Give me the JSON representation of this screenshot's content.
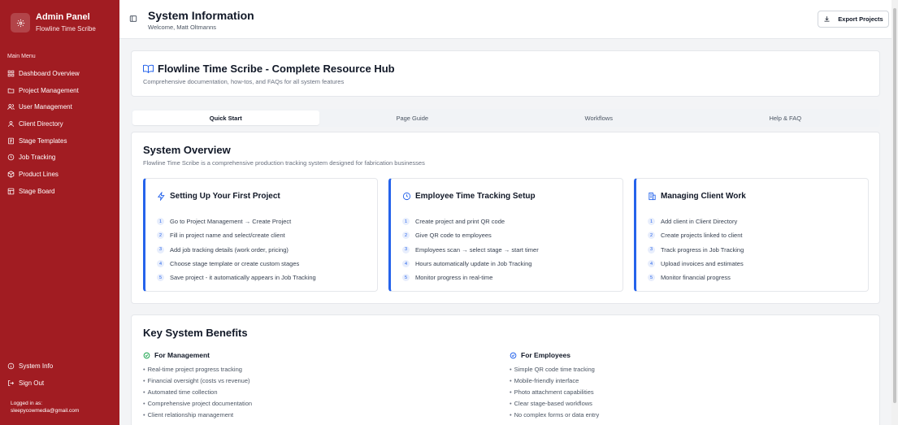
{
  "sidebar": {
    "title": "Admin Panel",
    "subtitle": "Flowline Time Scribe",
    "menu_label": "Main Menu",
    "items": [
      {
        "label": "Dashboard Overview",
        "icon": "grid-icon"
      },
      {
        "label": "Project Management",
        "icon": "folder-icon"
      },
      {
        "label": "User Management",
        "icon": "users-icon"
      },
      {
        "label": "Client Directory",
        "icon": "user-icon"
      },
      {
        "label": "Stage Templates",
        "icon": "layers-icon"
      },
      {
        "label": "Job Tracking",
        "icon": "clock-icon"
      },
      {
        "label": "Product Lines",
        "icon": "package-icon"
      },
      {
        "label": "Stage Board",
        "icon": "board-icon"
      }
    ],
    "bottom_items": [
      {
        "label": "System Info",
        "icon": "info-icon"
      },
      {
        "label": "Sign Out",
        "icon": "logout-icon"
      }
    ],
    "logged_in_label": "Logged in as:",
    "logged_in_email": "sleepycowmedia@gmail.com"
  },
  "header": {
    "title": "System Information",
    "welcome": "Welcome, Matt Oltmanns",
    "export_label": "Export Projects"
  },
  "hub": {
    "title": "Flowline Time Scribe - Complete Resource Hub",
    "subtitle": "Comprehensive documentation, how-tos, and FAQs for all system features"
  },
  "tabs": [
    {
      "label": "Quick Start",
      "active": true
    },
    {
      "label": "Page Guide",
      "active": false
    },
    {
      "label": "Workflows",
      "active": false
    },
    {
      "label": "Help & FAQ",
      "active": false
    }
  ],
  "overview": {
    "title": "System Overview",
    "subtitle": "Flowline Time Scribe is a comprehensive production tracking system designed for fabrication businesses",
    "cards": [
      {
        "title": "Setting Up Your First Project",
        "icon": "lightning-icon",
        "steps": [
          "Go to Project Management → Create Project",
          "Fill in project name and select/create client",
          "Add job tracking details (work order, pricing)",
          "Choose stage template or create custom stages",
          "Save project - it automatically appears in Job Tracking"
        ]
      },
      {
        "title": "Employee Time Tracking Setup",
        "icon": "clock-icon",
        "steps": [
          "Create project and print QR code",
          "Give QR code to employees",
          "Employees scan → select stage → start timer",
          "Hours automatically update in Job Tracking",
          "Monitor progress in real-time"
        ]
      },
      {
        "title": "Managing Client Work",
        "icon": "building-icon",
        "steps": [
          "Add client in Client Directory",
          "Create projects linked to client",
          "Track progress in Job Tracking",
          "Upload invoices and estimates",
          "Monitor financial progress"
        ]
      }
    ]
  },
  "benefits": {
    "title": "Key System Benefits",
    "management": {
      "title": "For Management",
      "items": [
        "Real-time project progress tracking",
        "Financial oversight (costs vs revenue)",
        "Automated time collection",
        "Comprehensive project documentation",
        "Client relationship management"
      ]
    },
    "employees": {
      "title": "For Employees",
      "items": [
        "Simple QR code time tracking",
        "Mobile-friendly interface",
        "Photo attachment capabilities",
        "Clear stage-based workflows",
        "No complex forms or data entry"
      ]
    }
  },
  "colors": {
    "sidebar": "#a11c22",
    "accent": "#2563eb",
    "success": "#16a34a"
  }
}
